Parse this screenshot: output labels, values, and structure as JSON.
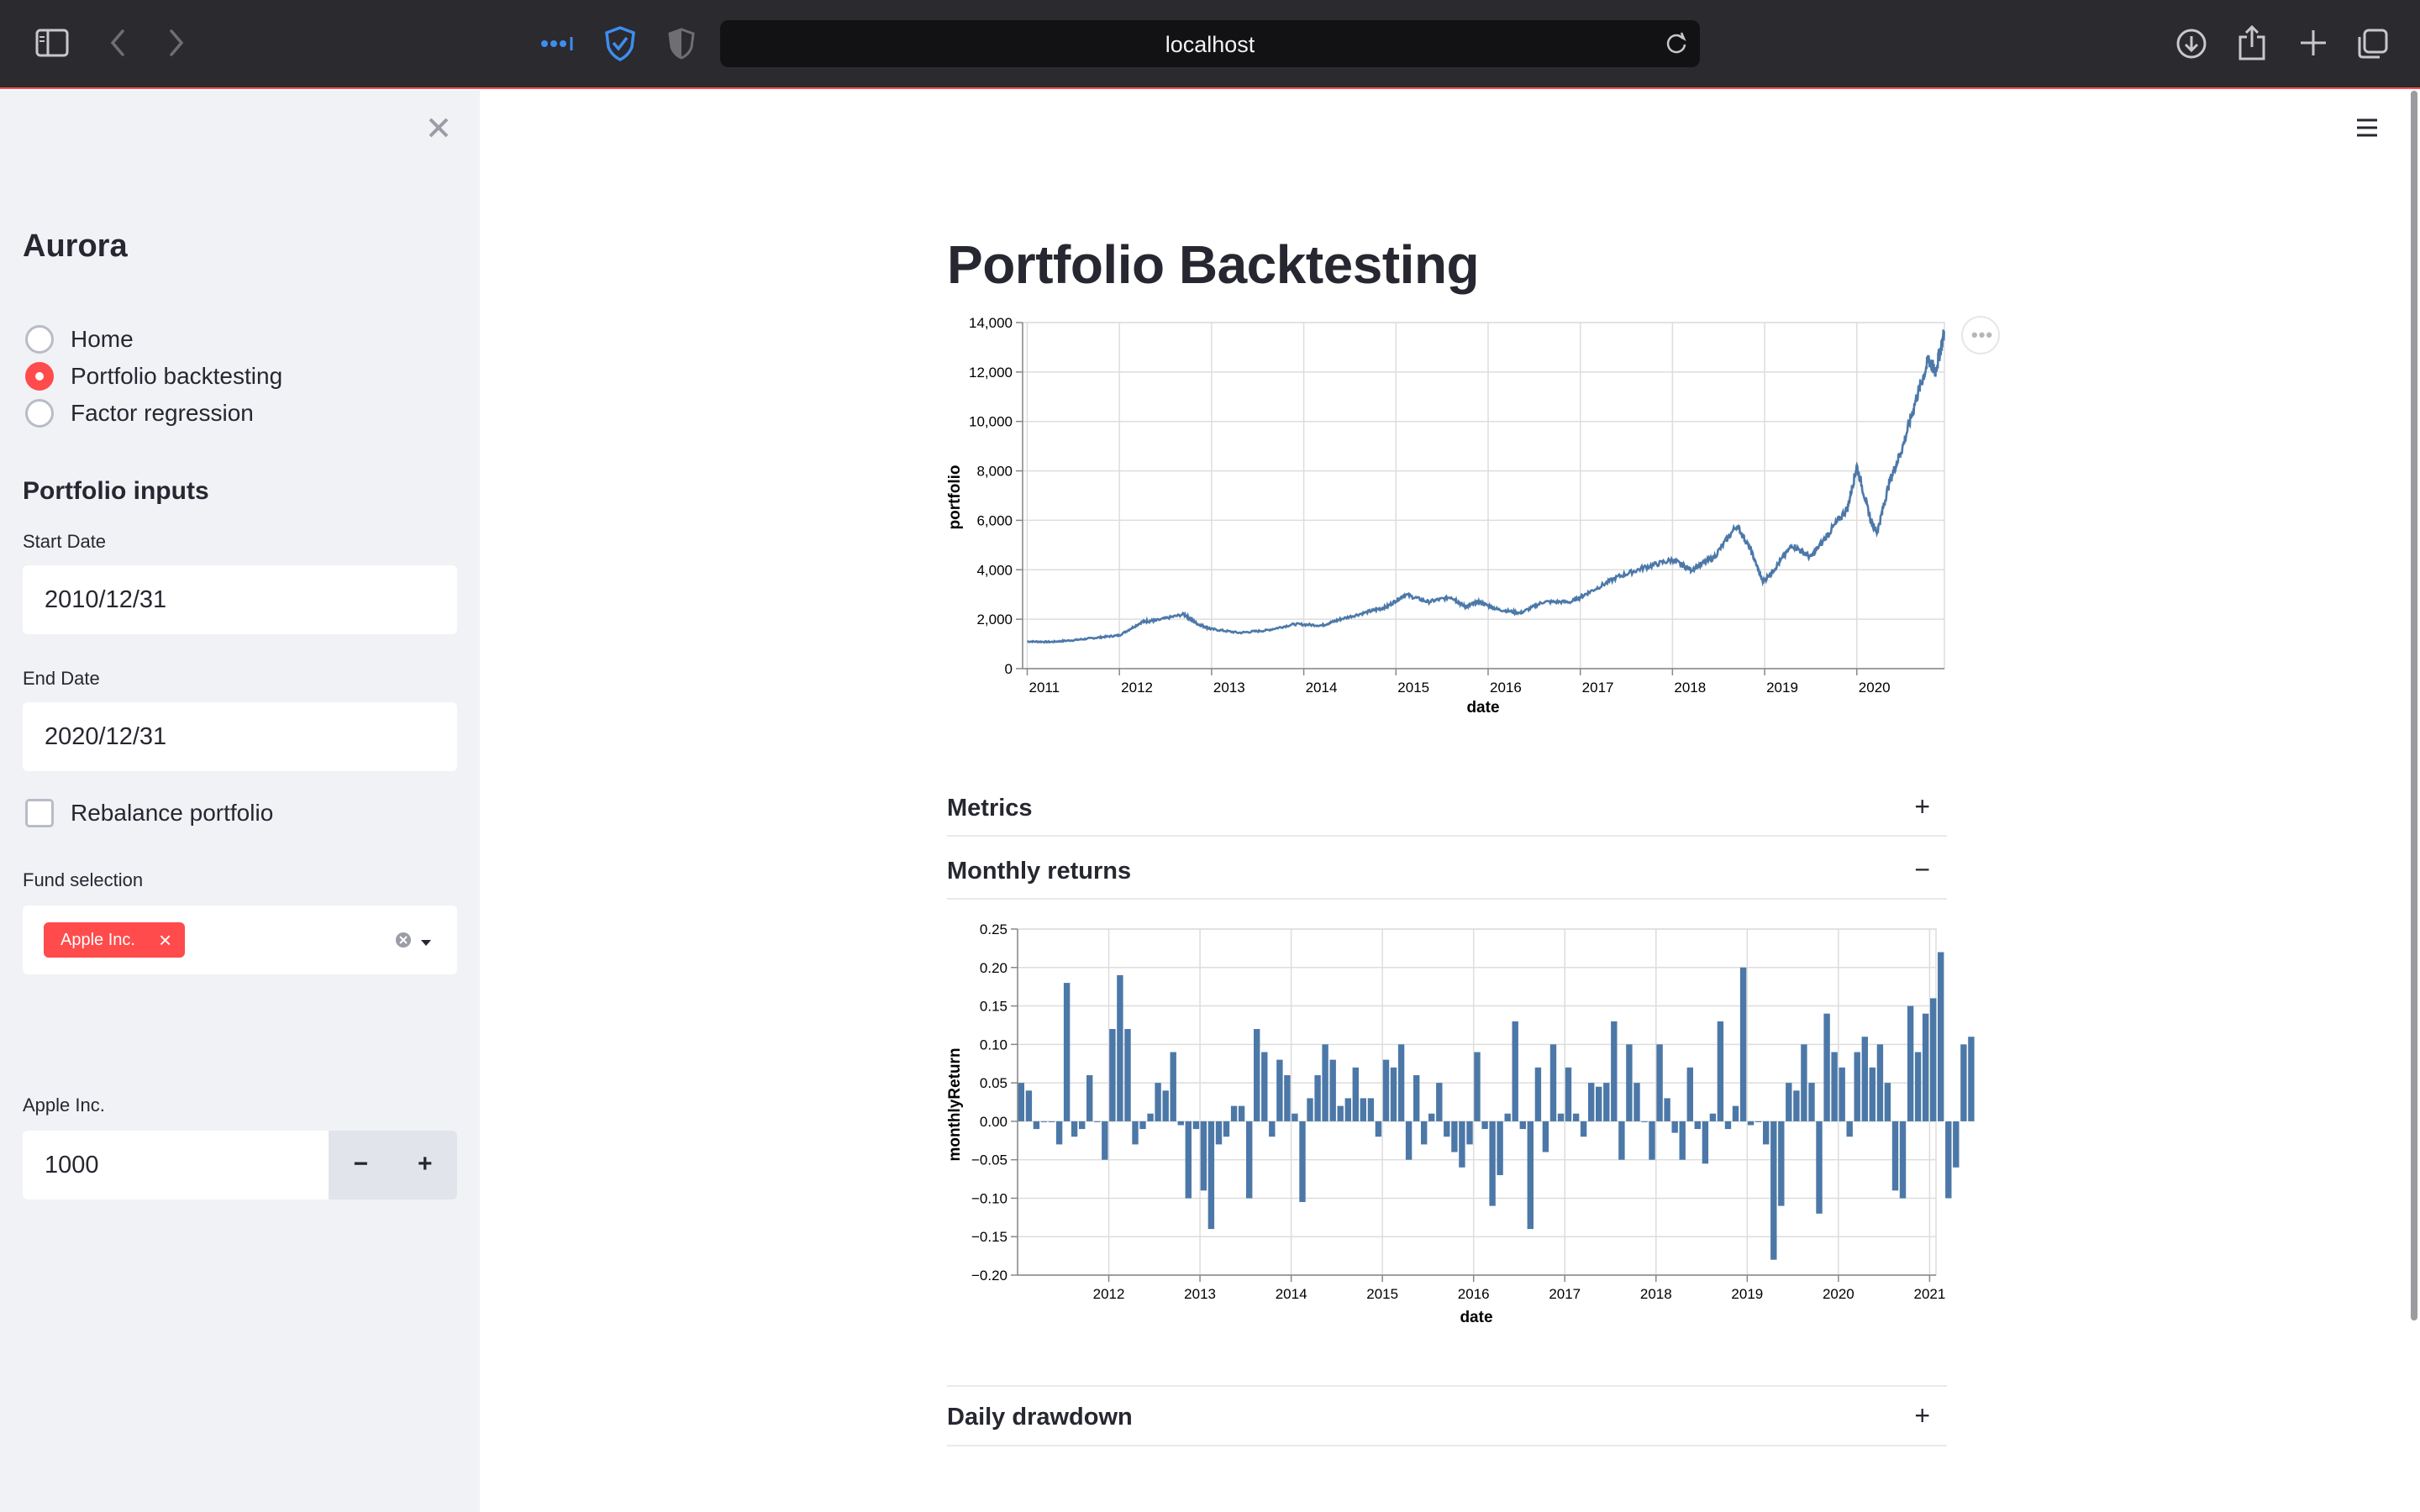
{
  "browser": {
    "url": "localhost",
    "icons": [
      "sidebar-toggle-icon",
      "back-icon",
      "forward-icon",
      "extensions-icon",
      "shield-icon",
      "privacy-icon",
      "reload-icon",
      "download-icon",
      "share-icon",
      "new-tab-icon",
      "tabs-icon"
    ]
  },
  "sidebar": {
    "app_title": "Aurora",
    "nav": [
      {
        "label": "Home",
        "selected": false
      },
      {
        "label": "Portfolio backtesting",
        "selected": true
      },
      {
        "label": "Factor regression",
        "selected": false
      }
    ],
    "inputs_heading": "Portfolio inputs",
    "start_date": {
      "label": "Start Date",
      "value": "2010/12/31"
    },
    "end_date": {
      "label": "End Date",
      "value": "2020/12/31"
    },
    "rebalance": {
      "label": "Rebalance portfolio",
      "checked": false
    },
    "fund_selection": {
      "label": "Fund selection",
      "tags": [
        "Apple Inc."
      ]
    },
    "amount": {
      "label": "Apple Inc.",
      "value": "1000",
      "minus": "−",
      "plus": "+"
    }
  },
  "main": {
    "title": "Portfolio Backtesting",
    "expanders": [
      {
        "label": "Metrics",
        "toggle": "+"
      },
      {
        "label": "Monthly returns",
        "toggle": "−"
      },
      {
        "label": "Daily drawdown",
        "toggle": "+"
      }
    ]
  },
  "colors": {
    "accent": "#ff4b4b",
    "series": "#4c78a8",
    "sidebar_bg": "#f0f2f6",
    "grid": "#dddddd"
  },
  "chart_data": [
    {
      "type": "line",
      "xlabel": "date",
      "ylabel": "portfolio",
      "ylim": [
        0,
        14000
      ],
      "yticks": [
        0,
        2000,
        4000,
        6000,
        8000,
        10000,
        12000,
        14000
      ],
      "ytick_labels": [
        "0",
        "2,000",
        "4,000",
        "6,000",
        "8,000",
        "10,000",
        "12,000",
        "14,000"
      ],
      "xticks": [
        2011,
        2012,
        2013,
        2014,
        2015,
        2016,
        2017,
        2018,
        2019,
        2020
      ],
      "xlim": [
        2010.95,
        2020.95
      ],
      "grid": true,
      "series": [
        {
          "x": [
            2011.0,
            2011.25,
            2011.5,
            2011.75,
            2012.0,
            2012.25,
            2012.4,
            2012.7,
            2012.85,
            2013.0,
            2013.3,
            2013.6,
            2013.9,
            2014.2,
            2014.4,
            2014.7,
            2014.9,
            2015.1,
            2015.35,
            2015.6,
            2015.75,
            2015.9,
            2016.1,
            2016.35,
            2016.6,
            2016.9,
            2017.1,
            2017.4,
            2017.7,
            2018.0,
            2018.2,
            2018.45,
            2018.7,
            2018.85,
            2018.98,
            2019.1,
            2019.3,
            2019.5,
            2019.7,
            2019.9,
            2020.0,
            2020.15,
            2020.22,
            2020.35,
            2020.5,
            2020.65,
            2020.78,
            2020.85,
            2020.95
          ],
          "y": [
            1100,
            1080,
            1150,
            1250,
            1350,
            1900,
            1950,
            2200,
            1800,
            1600,
            1450,
            1550,
            1800,
            1750,
            2000,
            2300,
            2500,
            3000,
            2700,
            2900,
            2500,
            2700,
            2400,
            2250,
            2700,
            2700,
            3100,
            3700,
            4100,
            4400,
            4000,
            4500,
            5800,
            4800,
            3500,
            4000,
            5000,
            4500,
            5500,
            6500,
            8200,
            6000,
            5500,
            7500,
            9000,
            11000,
            12500,
            12000,
            13600
          ]
        }
      ]
    },
    {
      "type": "bar",
      "xlabel": "date",
      "ylabel": "monthlyReturn",
      "ylim": [
        -0.2,
        0.25
      ],
      "yticks": [
        -0.2,
        -0.15,
        -0.1,
        -0.05,
        0,
        0.05,
        0.1,
        0.15,
        0.2,
        0.25
      ],
      "ytick_labels": [
        "−0.20",
        "−0.15",
        "−0.10",
        "−0.05",
        "0.00",
        "0.05",
        "0.10",
        "0.15",
        "0.20",
        "0.25"
      ],
      "xticks": [
        2012,
        2013,
        2014,
        2015,
        2016,
        2017,
        2018,
        2019,
        2020,
        2021
      ],
      "xlim": [
        2011.0,
        2021.07
      ],
      "grid": true,
      "series": [
        {
          "name": "monthlyReturn",
          "start": 2011.04,
          "step": 0.08333,
          "values": [
            0.05,
            0.04,
            -0.01,
            0.0,
            0.0,
            -0.03,
            0.18,
            -0.02,
            -0.01,
            0.06,
            0.0,
            -0.05,
            0.12,
            0.19,
            0.12,
            -0.03,
            -0.01,
            0.01,
            0.05,
            0.04,
            0.09,
            -0.005,
            -0.1,
            -0.01,
            -0.09,
            -0.14,
            -0.03,
            -0.02,
            0.02,
            0.02,
            -0.1,
            0.12,
            0.09,
            -0.02,
            0.08,
            0.06,
            0.01,
            -0.105,
            0.03,
            0.06,
            0.1,
            0.08,
            0.02,
            0.03,
            0.07,
            0.03,
            0.03,
            -0.02,
            0.08,
            0.07,
            0.1,
            -0.05,
            0.06,
            -0.03,
            0.01,
            0.05,
            -0.02,
            -0.04,
            -0.06,
            -0.03,
            0.09,
            -0.01,
            -0.11,
            -0.07,
            0.01,
            0.13,
            -0.01,
            -0.14,
            0.07,
            -0.04,
            0.1,
            0.01,
            0.07,
            0.01,
            -0.02,
            0.05,
            0.045,
            0.05,
            0.13,
            -0.05,
            0.1,
            0.05,
            0.0,
            -0.05,
            0.1,
            0.03,
            -0.015,
            -0.05,
            0.07,
            -0.01,
            -0.055,
            0.01,
            0.13,
            -0.01,
            0.02,
            0.2,
            -0.005,
            0.0,
            -0.03,
            -0.18,
            -0.11,
            0.05,
            0.04,
            0.1,
            0.05,
            -0.12,
            0.14,
            0.09,
            0.07,
            -0.02,
            0.09,
            0.11,
            0.07,
            0.1,
            0.05,
            -0.09,
            -0.1,
            0.15,
            0.09,
            0.14,
            0.16,
            0.22,
            -0.1,
            -0.06,
            0.1,
            0.11
          ]
        }
      ]
    }
  ]
}
